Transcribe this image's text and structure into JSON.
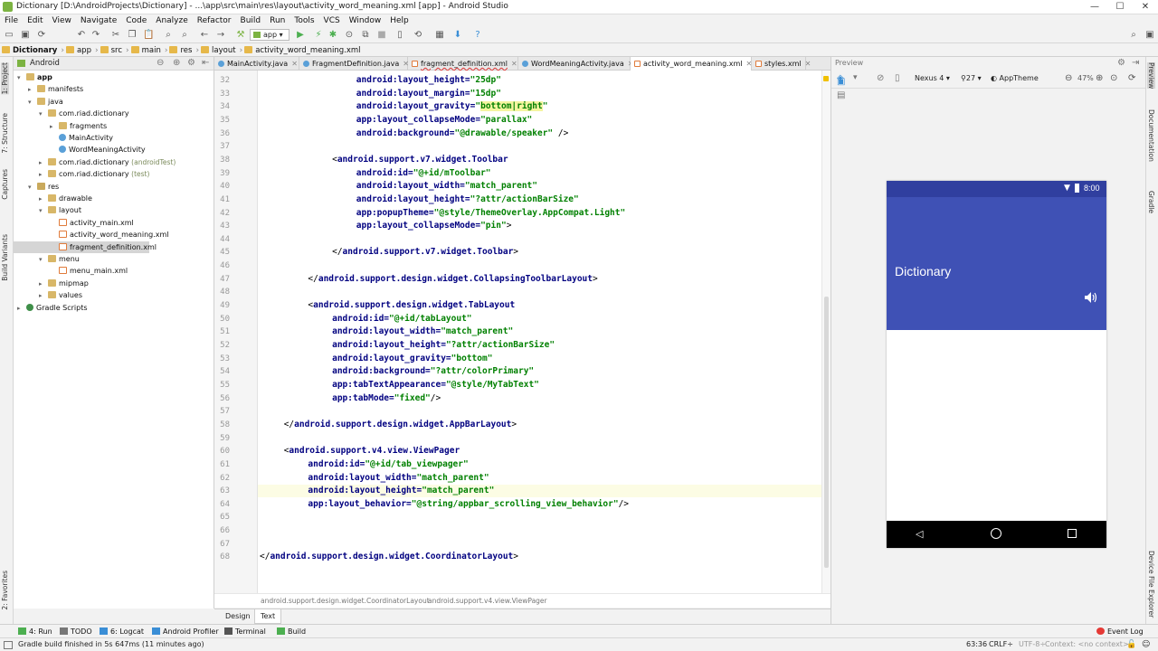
{
  "window": {
    "title": "Dictionary [D:\\AndroidProjects\\Dictionary] - ...\\app\\src\\main\\res\\layout\\activity_word_meaning.xml [app] - Android Studio",
    "min": "—",
    "max": "☐",
    "close": "✕"
  },
  "menu": [
    "File",
    "Edit",
    "View",
    "Navigate",
    "Code",
    "Analyze",
    "Refactor",
    "Build",
    "Run",
    "Tools",
    "VCS",
    "Window",
    "Help"
  ],
  "toolbar": {
    "config": "app"
  },
  "navbar": [
    "Dictionary",
    "app",
    "src",
    "main",
    "res",
    "layout",
    "activity_word_meaning.xml"
  ],
  "project": {
    "view": "Android",
    "tree": [
      {
        "label": "app",
        "level": 0,
        "arrow": "▾",
        "icon": "folder",
        "bold": true
      },
      {
        "label": "manifests",
        "level": 1,
        "arrow": "▸",
        "icon": "folder"
      },
      {
        "label": "java",
        "level": 1,
        "arrow": "▾",
        "icon": "folder"
      },
      {
        "label": "com.riad.dictionary",
        "level": 2,
        "arrow": "▾",
        "icon": "folder"
      },
      {
        "label": "fragments",
        "level": 3,
        "arrow": "▸",
        "icon": "folder"
      },
      {
        "label": "MainActivity",
        "level": 3,
        "arrow": "",
        "icon": "cls"
      },
      {
        "label": "WordMeaningActivity",
        "level": 3,
        "arrow": "",
        "icon": "cls"
      },
      {
        "label": "com.riad.dictionary",
        "sub": "(androidTest)",
        "level": 2,
        "arrow": "▸",
        "icon": "folder"
      },
      {
        "label": "com.riad.dictionary",
        "sub": "(test)",
        "level": 2,
        "arrow": "▸",
        "icon": "folder"
      },
      {
        "label": "res",
        "level": 1,
        "arrow": "▾",
        "icon": "res"
      },
      {
        "label": "drawable",
        "level": 2,
        "arrow": "▸",
        "icon": "folder"
      },
      {
        "label": "layout",
        "level": 2,
        "arrow": "▾",
        "icon": "folder"
      },
      {
        "label": "activity_main.xml",
        "level": 3,
        "arrow": "",
        "icon": "file"
      },
      {
        "label": "activity_word_meaning.xml",
        "level": 3,
        "arrow": "",
        "icon": "file"
      },
      {
        "label": "fragment_definition.xml",
        "level": 3,
        "arrow": "",
        "icon": "file",
        "selected": true
      },
      {
        "label": "menu",
        "level": 2,
        "arrow": "▾",
        "icon": "folder"
      },
      {
        "label": "menu_main.xml",
        "level": 3,
        "arrow": "",
        "icon": "file"
      },
      {
        "label": "mipmap",
        "level": 2,
        "arrow": "▸",
        "icon": "folder"
      },
      {
        "label": "values",
        "level": 2,
        "arrow": "▸",
        "icon": "folder"
      },
      {
        "label": "Gradle Scripts",
        "level": 0,
        "arrow": "▸",
        "icon": "gradle"
      }
    ]
  },
  "tabs": [
    {
      "label": "MainActivity.java",
      "type": "java"
    },
    {
      "label": "FragmentDefinition.java",
      "type": "java"
    },
    {
      "label": "fragment_definition.xml",
      "type": "xml"
    },
    {
      "label": "WordMeaningActivity.java",
      "type": "java"
    },
    {
      "label": "activity_word_meaning.xml",
      "type": "xml",
      "active": true
    },
    {
      "label": "styles.xml",
      "type": "xml"
    }
  ],
  "code": [
    {
      "n": "32",
      "i": 4,
      "t": [
        [
          "a",
          "android:layout_height="
        ],
        [
          "v",
          "\"25dp\""
        ]
      ]
    },
    {
      "n": "33",
      "i": 4,
      "t": [
        [
          "a",
          "android:layout_margin="
        ],
        [
          "v",
          "\"15dp\""
        ]
      ]
    },
    {
      "n": "34",
      "i": 4,
      "t": [
        [
          "a",
          "android:layout_gravity="
        ],
        [
          "v",
          "\""
        ],
        [
          "h",
          "bottom|right"
        ],
        [
          "v",
          "\""
        ]
      ]
    },
    {
      "n": "35",
      "i": 4,
      "t": [
        [
          "a",
          "app:layout_collapseMode="
        ],
        [
          "v",
          "\"parallax\""
        ]
      ]
    },
    {
      "n": "36",
      "i": 4,
      "t": [
        [
          "a",
          "android:background="
        ],
        [
          "v",
          "\"@drawable/speaker\""
        ],
        [
          "p",
          " />"
        ]
      ]
    },
    {
      "n": "37",
      "i": 0,
      "t": []
    },
    {
      "n": "38",
      "i": 3,
      "t": [
        [
          "p",
          "<"
        ],
        [
          "a",
          "android.support.v7.widget.Toolbar"
        ]
      ]
    },
    {
      "n": "39",
      "i": 4,
      "t": [
        [
          "a",
          "android:id="
        ],
        [
          "v",
          "\"@+id/mToolbar\""
        ]
      ]
    },
    {
      "n": "40",
      "i": 4,
      "t": [
        [
          "a",
          "android:layout_width="
        ],
        [
          "v",
          "\"match_parent\""
        ]
      ]
    },
    {
      "n": "41",
      "i": 4,
      "t": [
        [
          "a",
          "android:layout_height="
        ],
        [
          "v",
          "\"?attr/actionBarSize\""
        ]
      ]
    },
    {
      "n": "42",
      "i": 4,
      "t": [
        [
          "a",
          "app:popupTheme="
        ],
        [
          "v",
          "\"@style/ThemeOverlay.AppCompat.Light\""
        ]
      ]
    },
    {
      "n": "43",
      "i": 4,
      "t": [
        [
          "a",
          "app:layout_collapseMode="
        ],
        [
          "v",
          "\"pin\""
        ],
        [
          "p",
          ">"
        ]
      ]
    },
    {
      "n": "44",
      "i": 0,
      "t": []
    },
    {
      "n": "45",
      "i": 3,
      "t": [
        [
          "p",
          "</"
        ],
        [
          "a",
          "android.support.v7.widget.Toolbar"
        ],
        [
          "p",
          ">"
        ]
      ]
    },
    {
      "n": "46",
      "i": 0,
      "t": []
    },
    {
      "n": "47",
      "i": 2,
      "t": [
        [
          "p",
          "</"
        ],
        [
          "a",
          "android.support.design.widget.CollapsingToolbarLayout"
        ],
        [
          "p",
          ">"
        ]
      ]
    },
    {
      "n": "48",
      "i": 0,
      "t": []
    },
    {
      "n": "49",
      "i": 2,
      "t": [
        [
          "p",
          "<"
        ],
        [
          "a",
          "android.support.design.widget.TabLayout"
        ]
      ]
    },
    {
      "n": "50",
      "i": 3,
      "t": [
        [
          "a",
          "android:id="
        ],
        [
          "v",
          "\"@+id/tabLayout\""
        ]
      ]
    },
    {
      "n": "51",
      "i": 3,
      "t": [
        [
          "a",
          "android:layout_width="
        ],
        [
          "v",
          "\"match_parent\""
        ]
      ]
    },
    {
      "n": "52",
      "i": 3,
      "t": [
        [
          "a",
          "android:layout_height="
        ],
        [
          "v",
          "\"?attr/actionBarSize\""
        ]
      ]
    },
    {
      "n": "53",
      "i": 3,
      "t": [
        [
          "a",
          "android:layout_gravity="
        ],
        [
          "v",
          "\"bottom\""
        ]
      ]
    },
    {
      "n": "54",
      "i": 3,
      "t": [
        [
          "a",
          "android:background="
        ],
        [
          "v",
          "\"?attr/colorPrimary\""
        ]
      ]
    },
    {
      "n": "55",
      "i": 3,
      "t": [
        [
          "a",
          "app:tabTextAppearance="
        ],
        [
          "v",
          "\"@style/MyTabText\""
        ]
      ]
    },
    {
      "n": "56",
      "i": 3,
      "t": [
        [
          "a",
          "app:tabMode="
        ],
        [
          "v",
          "\"fixed\""
        ],
        [
          "p",
          "/>"
        ]
      ]
    },
    {
      "n": "57",
      "i": 0,
      "t": []
    },
    {
      "n": "58",
      "i": 1,
      "t": [
        [
          "p",
          "</"
        ],
        [
          "a",
          "android.support.design.widget.AppBarLayout"
        ],
        [
          "p",
          ">"
        ]
      ]
    },
    {
      "n": "59",
      "i": 0,
      "t": []
    },
    {
      "n": "60",
      "i": 1,
      "t": [
        [
          "p",
          "<"
        ],
        [
          "a",
          "android.support.v4.view.ViewPager"
        ]
      ]
    },
    {
      "n": "61",
      "i": 2,
      "t": [
        [
          "a",
          "android:id="
        ],
        [
          "v",
          "\"@+id/tab_viewpager\""
        ]
      ]
    },
    {
      "n": "62",
      "i": 2,
      "t": [
        [
          "a",
          "android:layout_width="
        ],
        [
          "v",
          "\"match_parent\""
        ]
      ]
    },
    {
      "n": "63",
      "i": 2,
      "t": [
        [
          "a",
          "android:layout_height="
        ],
        [
          "v",
          "\"match_parent\""
        ]
      ],
      "current": true
    },
    {
      "n": "64",
      "i": 2,
      "t": [
        [
          "a",
          "app:layout_behavior="
        ],
        [
          "v",
          "\"@string/appbar_scrolling_view_behavior\""
        ],
        [
          "p",
          "/>"
        ]
      ]
    },
    {
      "n": "65",
      "i": 0,
      "t": []
    },
    {
      "n": "66",
      "i": 0,
      "t": []
    },
    {
      "n": "67",
      "i": 0,
      "t": []
    },
    {
      "n": "68",
      "i": 0,
      "t": [
        [
          "p",
          "</"
        ],
        [
          "a",
          "android.support.design.widget.CoordinatorLayout"
        ],
        [
          "p",
          ">"
        ]
      ]
    }
  ],
  "breadcrumbs": [
    "android.support.design.widget.CoordinatorLayout",
    "android.support.v4.view.ViewPager"
  ],
  "design_tabs": {
    "design": "Design",
    "text": "Text"
  },
  "preview": {
    "title": "Preview",
    "device": "Nexus 4",
    "api": "27",
    "theme": "AppTheme",
    "zoom": "47%",
    "phone": {
      "time": "8:00",
      "app_title": "Dictionary"
    }
  },
  "bottom_tools": [
    {
      "label": "4: Run",
      "icon": "run"
    },
    {
      "label": "TODO",
      "icon": "todo"
    },
    {
      "label": "6: Logcat",
      "icon": "logcat"
    },
    {
      "label": "Android Profiler",
      "icon": "profiler"
    },
    {
      "label": "Terminal",
      "icon": "terminal"
    },
    {
      "label": "Build",
      "icon": "build"
    }
  ],
  "event_log": "Event Log",
  "status": {
    "message": "Gradle build finished in 5s 647ms (11 minutes ago)",
    "position": "63:36",
    "line_sep": "CRLF÷",
    "encoding": "UTF-8÷",
    "context": "Context: <no context>"
  },
  "left_tabs": [
    "1: Project",
    "7: Structure",
    "Captures",
    "Build Variants",
    "2: Favorites"
  ],
  "right_tabs": [
    "Preview",
    "Documentation",
    "Gradle",
    "Device File Explorer"
  ],
  "colors": {
    "appbar": "#3f51b5",
    "statusbar": "#303f9f",
    "tag": "#000080",
    "value": "#008000"
  }
}
